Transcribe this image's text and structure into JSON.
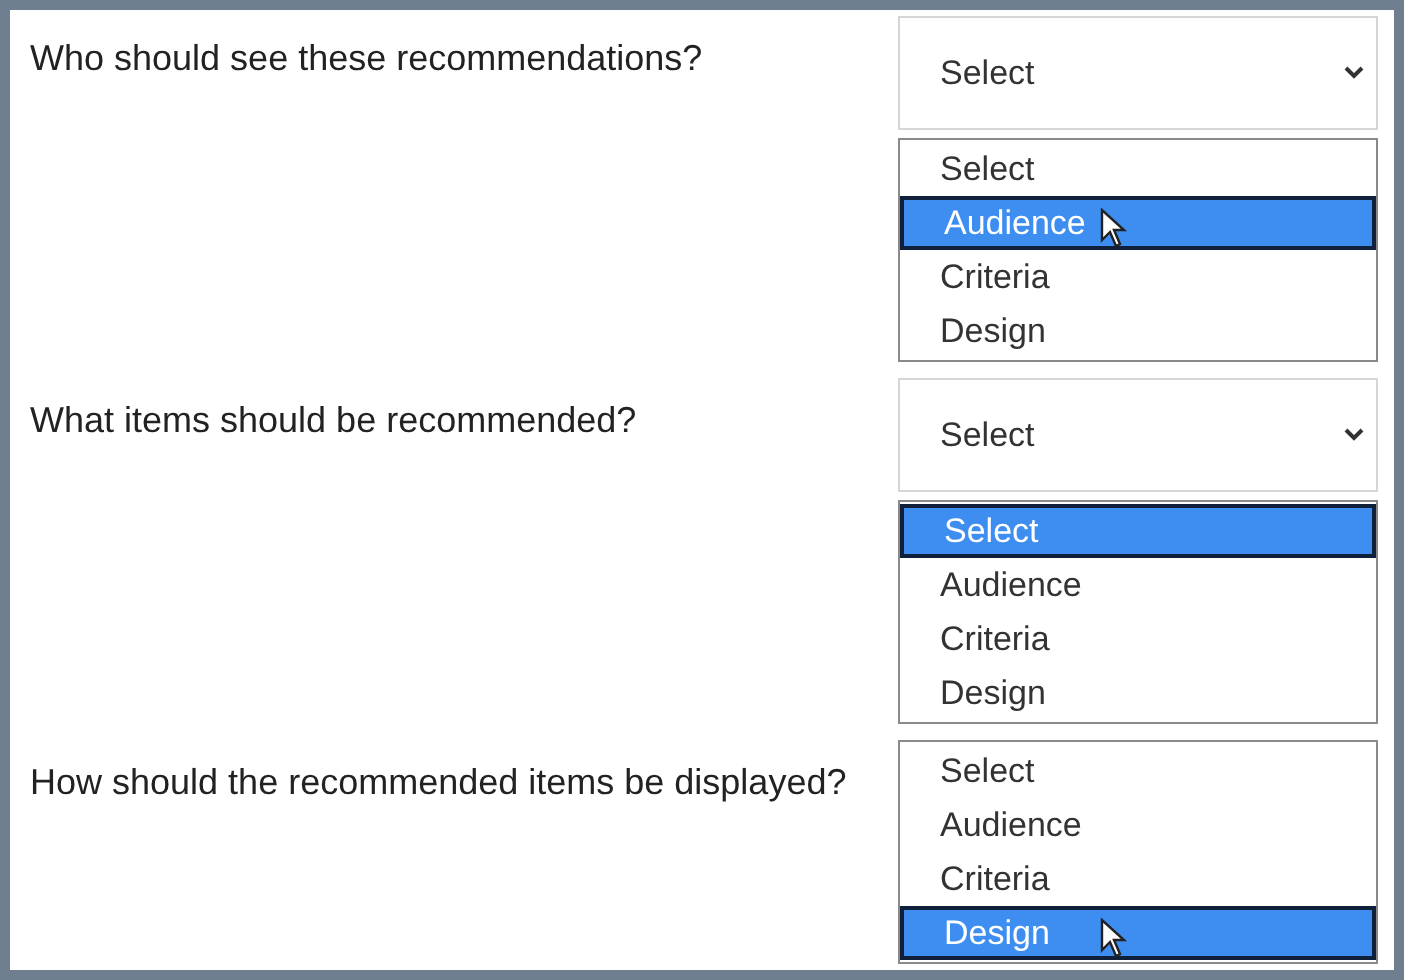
{
  "questions": [
    {
      "text": "Who should see these recommendations?",
      "dropdown": {
        "value": "Select"
      },
      "cursor": true,
      "options": [
        {
          "label": "Select",
          "selected": false
        },
        {
          "label": "Audience",
          "selected": true
        },
        {
          "label": "Criteria",
          "selected": false
        },
        {
          "label": "Design",
          "selected": false
        }
      ]
    },
    {
      "text": "What items should be recommended?",
      "dropdown": {
        "value": "Select"
      },
      "cursor": false,
      "options": [
        {
          "label": "Select",
          "selected": true
        },
        {
          "label": "Audience",
          "selected": false
        },
        {
          "label": "Criteria",
          "selected": false
        },
        {
          "label": "Design",
          "selected": false
        }
      ]
    },
    {
      "text": "How should the recommended items be displayed?",
      "cursor": true,
      "options": [
        {
          "label": "Select",
          "selected": false
        },
        {
          "label": "Audience",
          "selected": false
        },
        {
          "label": "Criteria",
          "selected": false
        },
        {
          "label": "Design",
          "selected": true
        }
      ]
    }
  ]
}
